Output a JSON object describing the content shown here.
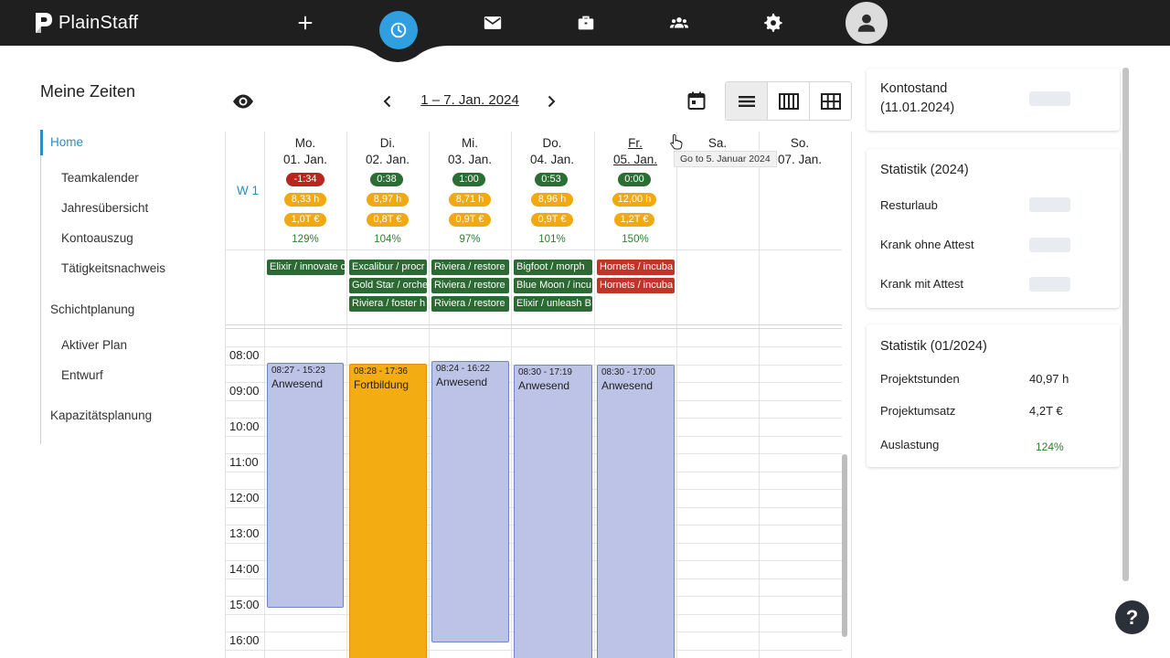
{
  "app": {
    "name": "PlainStaff"
  },
  "nav": {
    "items": [
      "add-icon",
      "clock-icon",
      "mail-icon",
      "briefcase-icon",
      "team-icon",
      "gear-icon",
      "avatar-icon"
    ],
    "active": "clock-icon",
    "accent": "#2f9fe0"
  },
  "sidebar": {
    "title": "Meine Zeiten",
    "items": [
      {
        "label": "Home",
        "active": true
      },
      {
        "label": "Teamkalender"
      },
      {
        "label": "Jahresübersicht"
      },
      {
        "label": "Kontoauszug"
      },
      {
        "label": "Tätigkeitsnachweis"
      },
      {
        "label": "Schichtplanung"
      },
      {
        "label": "Aktiver Plan"
      },
      {
        "label": "Entwurf"
      },
      {
        "label": "Kapazitätsplanung"
      }
    ]
  },
  "toolbar": {
    "date_range": "1 – 7. Jan. 2024",
    "views": [
      "list-view-icon",
      "week-view-icon",
      "month-view-icon"
    ],
    "selected_view": "week-view-icon"
  },
  "calendar": {
    "week_label": "W 1",
    "days": [
      {
        "name": "Mo.",
        "date": "01. Jan.",
        "balance": "-1:34",
        "balance_status": "red",
        "hours": "8,33 h",
        "revenue": "1,0T €",
        "pct": "129%"
      },
      {
        "name": "Di.",
        "date": "02. Jan.",
        "balance": "0:38",
        "balance_status": "green",
        "hours": "8,97 h",
        "revenue": "0,8T €",
        "pct": "104%"
      },
      {
        "name": "Mi.",
        "date": "03. Jan.",
        "balance": "1:00",
        "balance_status": "green",
        "hours": "8,71 h",
        "revenue": "0,9T €",
        "pct": "97%"
      },
      {
        "name": "Do.",
        "date": "04. Jan.",
        "balance": "0:53",
        "balance_status": "green",
        "hours": "8,96 h",
        "revenue": "0,9T €",
        "pct": "101%"
      },
      {
        "name": "Fr.",
        "date": "05. Jan.",
        "balance": "0:00",
        "balance_status": "green",
        "hours": "12,00 h",
        "revenue": "1,2T €",
        "pct": "150%"
      },
      {
        "name": "Sa.",
        "date": ""
      },
      {
        "name": "So.",
        "date": "07. Jan."
      }
    ],
    "projects": [
      [
        {
          "label": "Elixir / innovate c",
          "color": "green"
        }
      ],
      [
        {
          "label": "Excalibur / procr",
          "color": "green"
        },
        {
          "label": "Gold Star / orche",
          "color": "green"
        },
        {
          "label": "Riviera / foster h",
          "color": "green"
        }
      ],
      [
        {
          "label": "Riviera / restore",
          "color": "green"
        },
        {
          "label": "Riviera / restore",
          "color": "green"
        },
        {
          "label": "Riviera / restore",
          "color": "green"
        }
      ],
      [
        {
          "label": "Bigfoot / morph",
          "color": "green"
        },
        {
          "label": "Blue Moon / incu",
          "color": "green"
        },
        {
          "label": "Elixir / unleash B",
          "color": "green"
        }
      ],
      [
        {
          "label": "Hornets / incuba",
          "color": "red"
        },
        {
          "label": "Hornets / incuba",
          "color": "red"
        }
      ]
    ],
    "times": [
      "08:00",
      "09:00",
      "10:00",
      "11:00",
      "12:00",
      "13:00",
      "14:00",
      "15:00",
      "16:00"
    ],
    "events": [
      {
        "time": "08:27 - 15:23",
        "title": "Anwesend",
        "kind": "present"
      },
      {
        "time": "08:28 - 17:36",
        "title": "Fortbildung",
        "kind": "training"
      },
      {
        "time": "08:24 - 16:22",
        "title": "Anwesend",
        "kind": "present"
      },
      {
        "time": "08:30 - 17:19",
        "title": "Anwesend",
        "kind": "present"
      },
      {
        "time": "08:30 - 17:00",
        "title": "Anwesend",
        "kind": "present"
      }
    ],
    "tooltip": "Go to 5. Januar 2024"
  },
  "panel": {
    "account": {
      "title": "Kontostand\n(11.01.2024)"
    },
    "stats_year": {
      "title": "Statistik (2024)",
      "rows": [
        "Resturlaub",
        "Krank ohne Attest",
        "Krank mit Attest"
      ]
    },
    "stats_month": {
      "title": "Statistik (01/2024)",
      "rows": [
        {
          "label": "Projektstunden",
          "value": "40,97 h"
        },
        {
          "label": "Projektumsatz",
          "value": "4,2T €"
        },
        {
          "label": "Auslastung",
          "value": "124%"
        }
      ]
    }
  },
  "help": {
    "label": "?"
  }
}
